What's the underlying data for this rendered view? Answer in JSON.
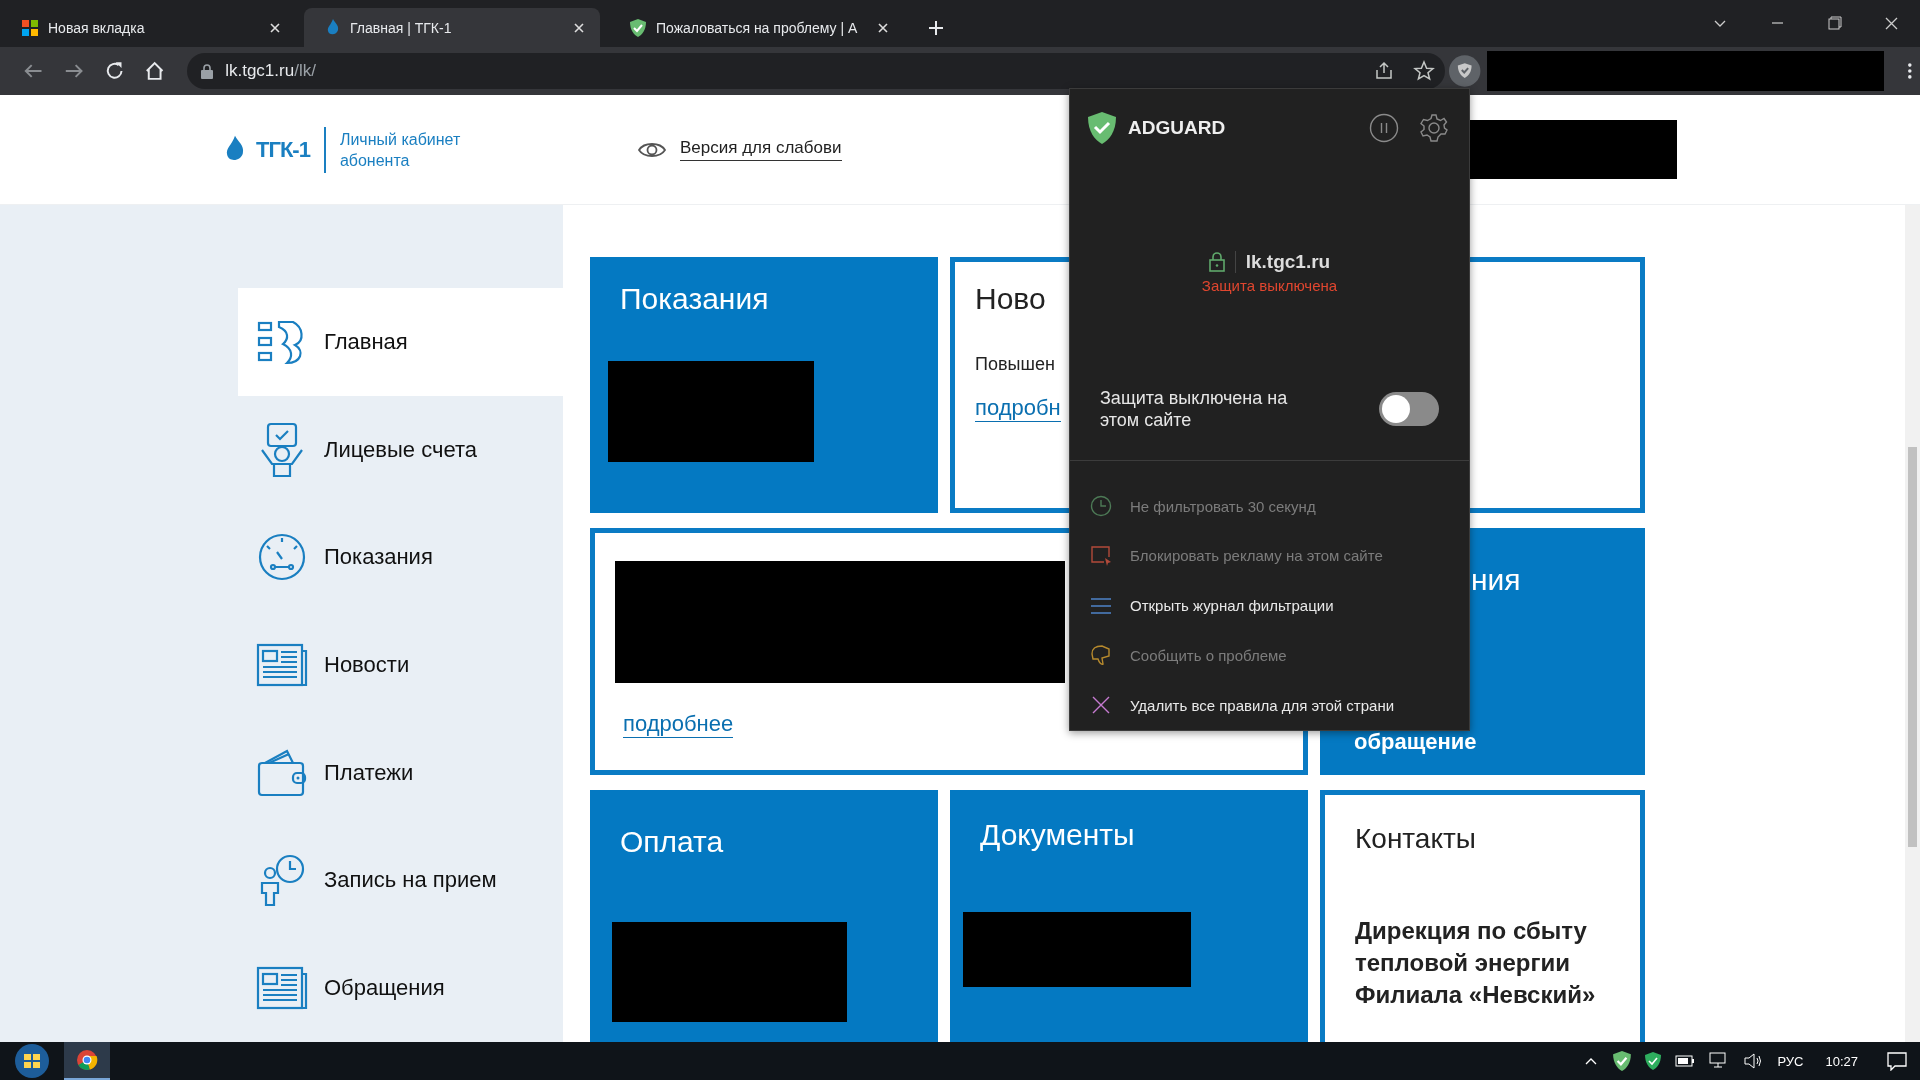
{
  "tabs": [
    {
      "kind": "windows",
      "title": "Новая вкладка",
      "selected": false
    },
    {
      "kind": "flame",
      "title": "Главная | ТГК-1",
      "selected": true
    },
    {
      "kind": "shield",
      "title": "Пожаловаться на проблему | A",
      "selected": false
    }
  ],
  "address_bar": {
    "domain": "lk.tgc1.ru",
    "path": "/lk/"
  },
  "header": {
    "logo_mark": "ТГК-1",
    "logo_caption": "Личный кабинет абонента",
    "accessibility_link": "Версия для слабови"
  },
  "sidebar": {
    "items": [
      {
        "kind": "home",
        "label": "Главная",
        "selected": true
      },
      {
        "kind": "accounts",
        "label": "Лицевые счета",
        "selected": false
      },
      {
        "kind": "meter",
        "label": "Показания",
        "selected": false
      },
      {
        "kind": "news",
        "label": "Новости",
        "selected": false
      },
      {
        "kind": "wallet",
        "label": "Платежи",
        "selected": false
      },
      {
        "kind": "appointment",
        "label": "Запись на прием",
        "selected": false
      },
      {
        "kind": "news",
        "label": "Обращения",
        "selected": false
      }
    ]
  },
  "tiles": [
    {
      "kind": "blue",
      "title": "Показания",
      "redacted": true
    },
    {
      "kind": "outline",
      "title": "Ново",
      "text": "Повышен",
      "link": "подробн"
    },
    {
      "kind": "outline"
    },
    {
      "kind": "outline",
      "redacted": true,
      "link": "подробнее"
    },
    {
      "kind": "blue",
      "title": "ния",
      "text": "обращение"
    },
    {
      "kind": "blue",
      "title": "Оплата",
      "redacted": true
    },
    {
      "kind": "blue",
      "title": "Документы",
      "redacted": true
    },
    {
      "kind": "outline",
      "title": "Контакты",
      "text": "Дирекция по сбыту тепловой энергии Филиала «Невский»"
    }
  ],
  "adguard_popup": {
    "brand": "ADGUARD",
    "site": "lk.tgc1.ru",
    "status": "Защита выключена",
    "toggle": {
      "label": "Защита выключена на этом сайте",
      "on": false
    },
    "actions": [
      {
        "kind": "clock",
        "label": "Не фильтровать 30 секунд",
        "disabled": true
      },
      {
        "kind": "block",
        "label": "Блокировать рекламу на этом сайте",
        "disabled": true
      },
      {
        "kind": "log",
        "label": "Открыть журнал фильтрации",
        "disabled": false
      },
      {
        "kind": "report",
        "label": "Сообщить о проблеме",
        "disabled": true
      },
      {
        "kind": "remove",
        "label": "Удалить все правила для этой страни",
        "disabled": false
      }
    ]
  },
  "taskbar": {
    "language": "РУС",
    "time": "10:27"
  }
}
